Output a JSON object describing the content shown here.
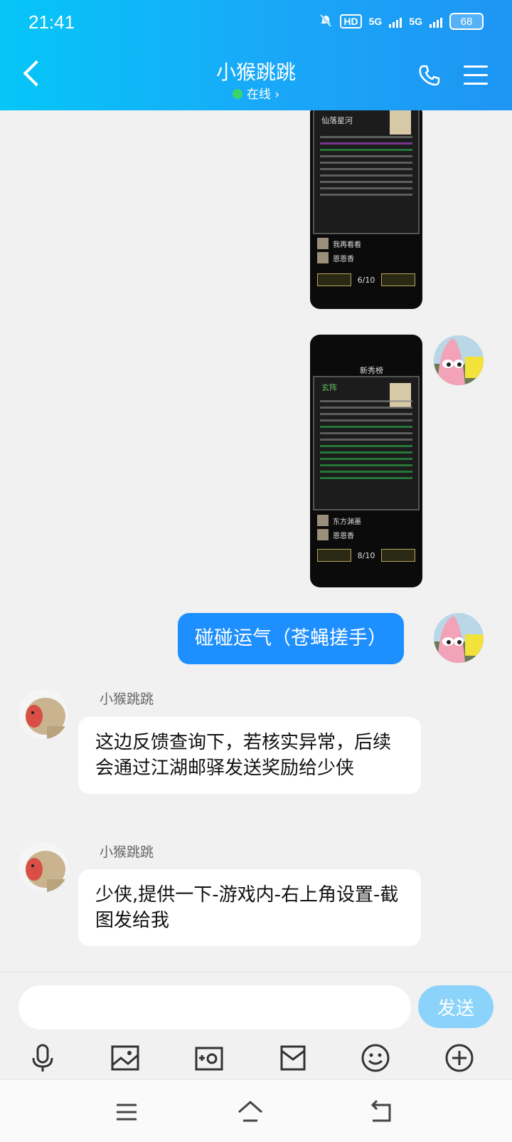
{
  "status_bar": {
    "time": "21:41",
    "hd": "HD",
    "net1": "5G",
    "net2": "5G",
    "battery": "68"
  },
  "header": {
    "title": "小猴跳跳",
    "status": "在线 ›"
  },
  "screenshot1": {
    "caption_top": "仙落星河",
    "row1": "我再看看",
    "row2": "恩恩香",
    "page": "6/10"
  },
  "screenshot2": {
    "tab": "新秀榜",
    "caption_top": "玄阵",
    "row1": "东方渊墨",
    "row2": "恩恩香",
    "page": "8/10"
  },
  "messages": {
    "me_text": "碰碰运气（苍蝇搓手）",
    "other1_name": "小猴跳跳",
    "other1_text": "这边反馈查询下，若核实异常，后续会通过江湖邮驿发送奖励给少侠",
    "other2_name": "小猴跳跳",
    "other2_text": "少侠,提供一下-游戏内-右上角设置-截图发给我"
  },
  "composer": {
    "input_value": "",
    "send_label": "发送"
  },
  "icons": [
    "voice-icon",
    "image-icon",
    "camera-icon",
    "pocket-icon",
    "emoji-icon",
    "plus-icon"
  ],
  "colors": {
    "accent": "#1e8fff",
    "header_from": "#05c6f7",
    "header_to": "#1e95f3",
    "send_disabled": "#8bd3fb"
  }
}
